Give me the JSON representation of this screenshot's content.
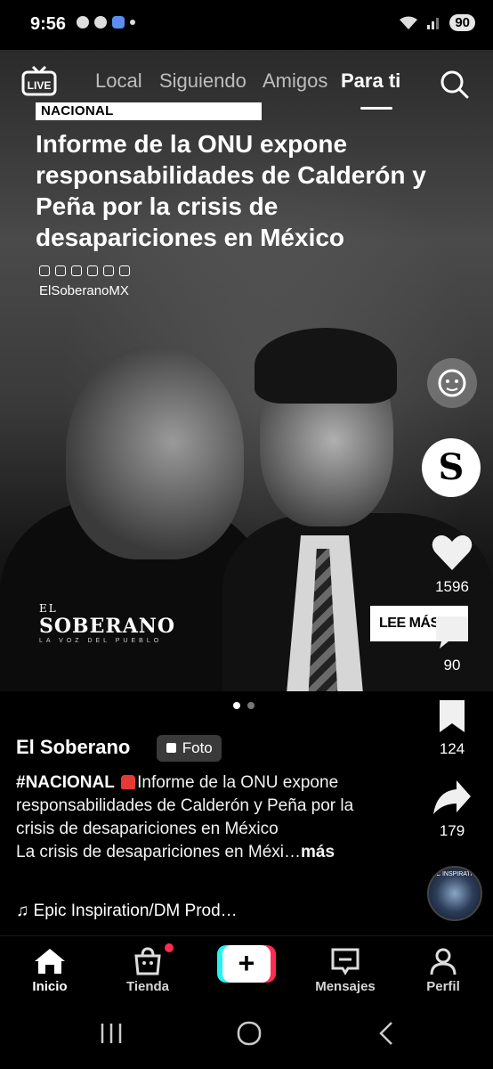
{
  "status_bar": {
    "time": "9:56",
    "battery": "90"
  },
  "top_nav": {
    "live_label": "LIVE",
    "tabs": [
      "Local",
      "Siguiendo",
      "Amigos",
      "Para ti"
    ],
    "active_tab": "Para ti"
  },
  "post": {
    "section_tag": "NACIONAL",
    "headline": "Informe de la ONU expone responsabilidades de Calderón y Peña por la crisis de desapariciones en México",
    "social_handle": "ElSoberanoMX",
    "watermark": {
      "top": "EL",
      "name": "SOBERANO",
      "sub": "LA VOZ DEL PUEBLO"
    },
    "cta": "LEE MÁS >>",
    "image_count": 2,
    "active_image": 1
  },
  "rail": {
    "avatar_letter": "S",
    "likes": "1596",
    "comments": "90",
    "saves": "124",
    "shares": "179"
  },
  "caption": {
    "author": "El Soberano",
    "badge": "Foto",
    "hashtag": "#NACIONAL",
    "text": "Informe de la ONU expone responsabilidades de Calderón y Peña por la crisis de desapariciones en México",
    "second_line": "La crisis de desapariciones en Méxi…",
    "more": "más",
    "music": "Epic Inspiration/DM Prod…",
    "music_disc_text": "IC INSPIRATI"
  },
  "bottom_nav": {
    "items": [
      "Inicio",
      "Tienda",
      "Mensajes",
      "Perfil"
    ],
    "active": "Inicio",
    "plus": "+"
  },
  "colors": {
    "accent_cyan": "#25f4ee",
    "accent_red": "#fe2c55",
    "background": "#000000"
  }
}
